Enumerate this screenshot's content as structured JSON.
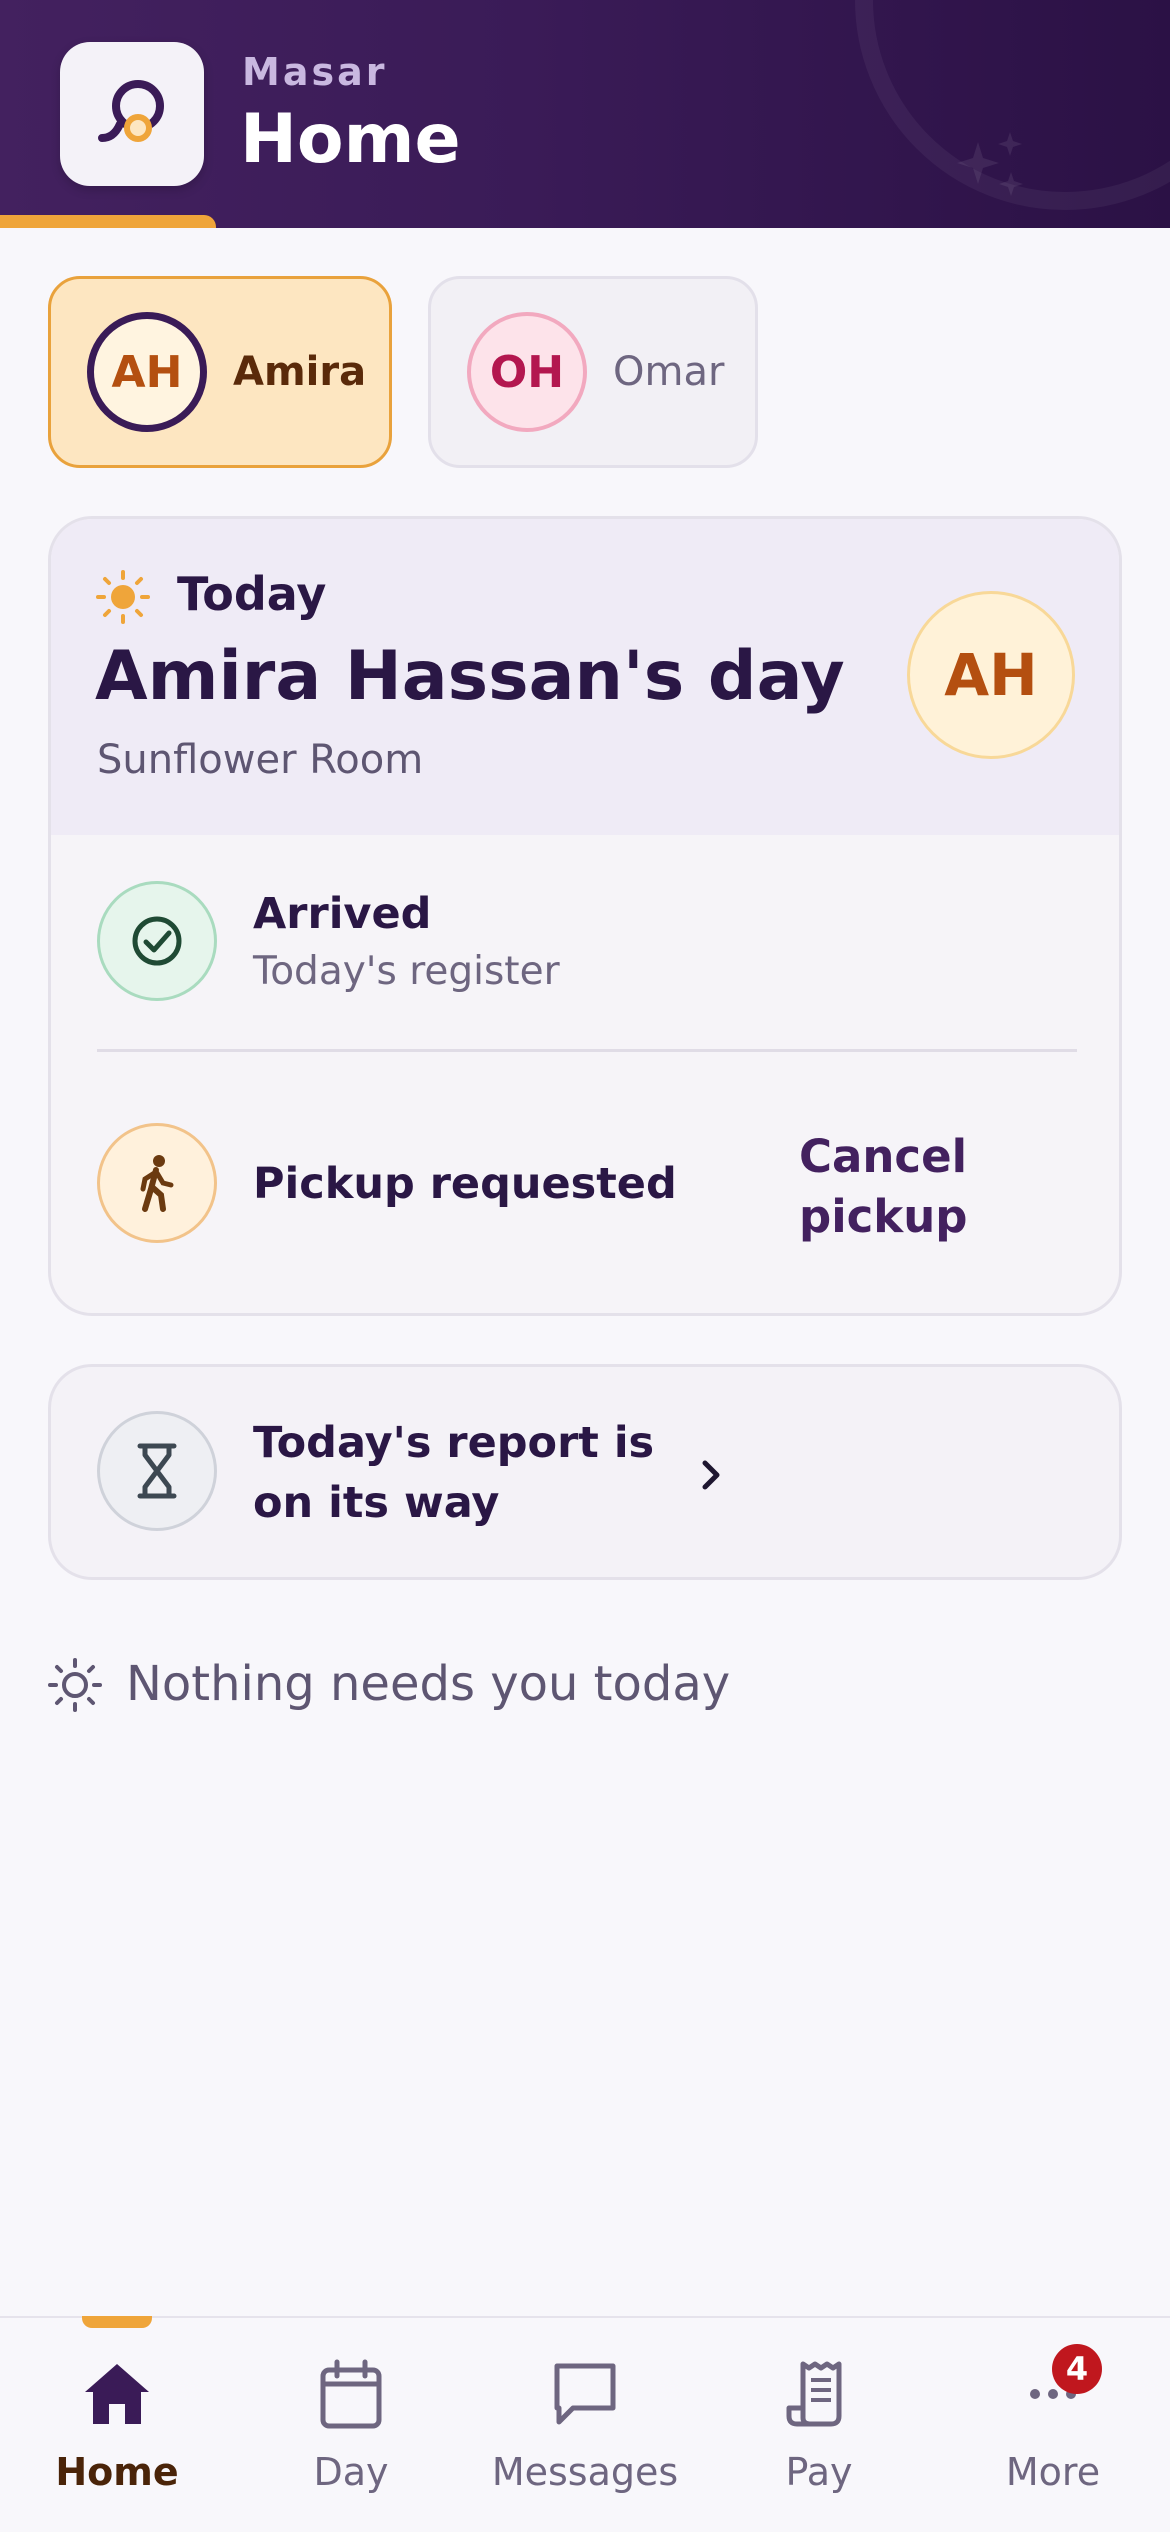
{
  "header": {
    "app_name": "Masar",
    "title": "Home"
  },
  "children": [
    {
      "initials": "AH",
      "name": "Amira",
      "selected": true
    },
    {
      "initials": "OH",
      "name": "Omar",
      "selected": false
    }
  ],
  "today_card": {
    "label": "Today",
    "title": "Amira Hassan's day",
    "room": "Sunflower Room",
    "avatar_initials": "AH",
    "arrived": {
      "title": "Arrived",
      "subtitle": "Today's register"
    },
    "pickup": {
      "title": "Pickup requested",
      "action": "Cancel pickup"
    }
  },
  "report_card": {
    "title": "Today's report is on its way"
  },
  "empty_state": {
    "text": "Nothing needs you today"
  },
  "tab_bar": {
    "tabs": [
      {
        "label": "Home",
        "icon": "home-icon",
        "active": true
      },
      {
        "label": "Day",
        "icon": "calendar-icon",
        "active": false
      },
      {
        "label": "Messages",
        "icon": "chat-icon",
        "active": false
      },
      {
        "label": "Pay",
        "icon": "receipt-icon",
        "active": false
      },
      {
        "label": "More",
        "icon": "more-icon",
        "active": false,
        "badge": "4"
      }
    ]
  },
  "colors": {
    "brand_purple": "#3a1b57",
    "accent_orange": "#efa53a",
    "badge_red": "#c0171e"
  }
}
